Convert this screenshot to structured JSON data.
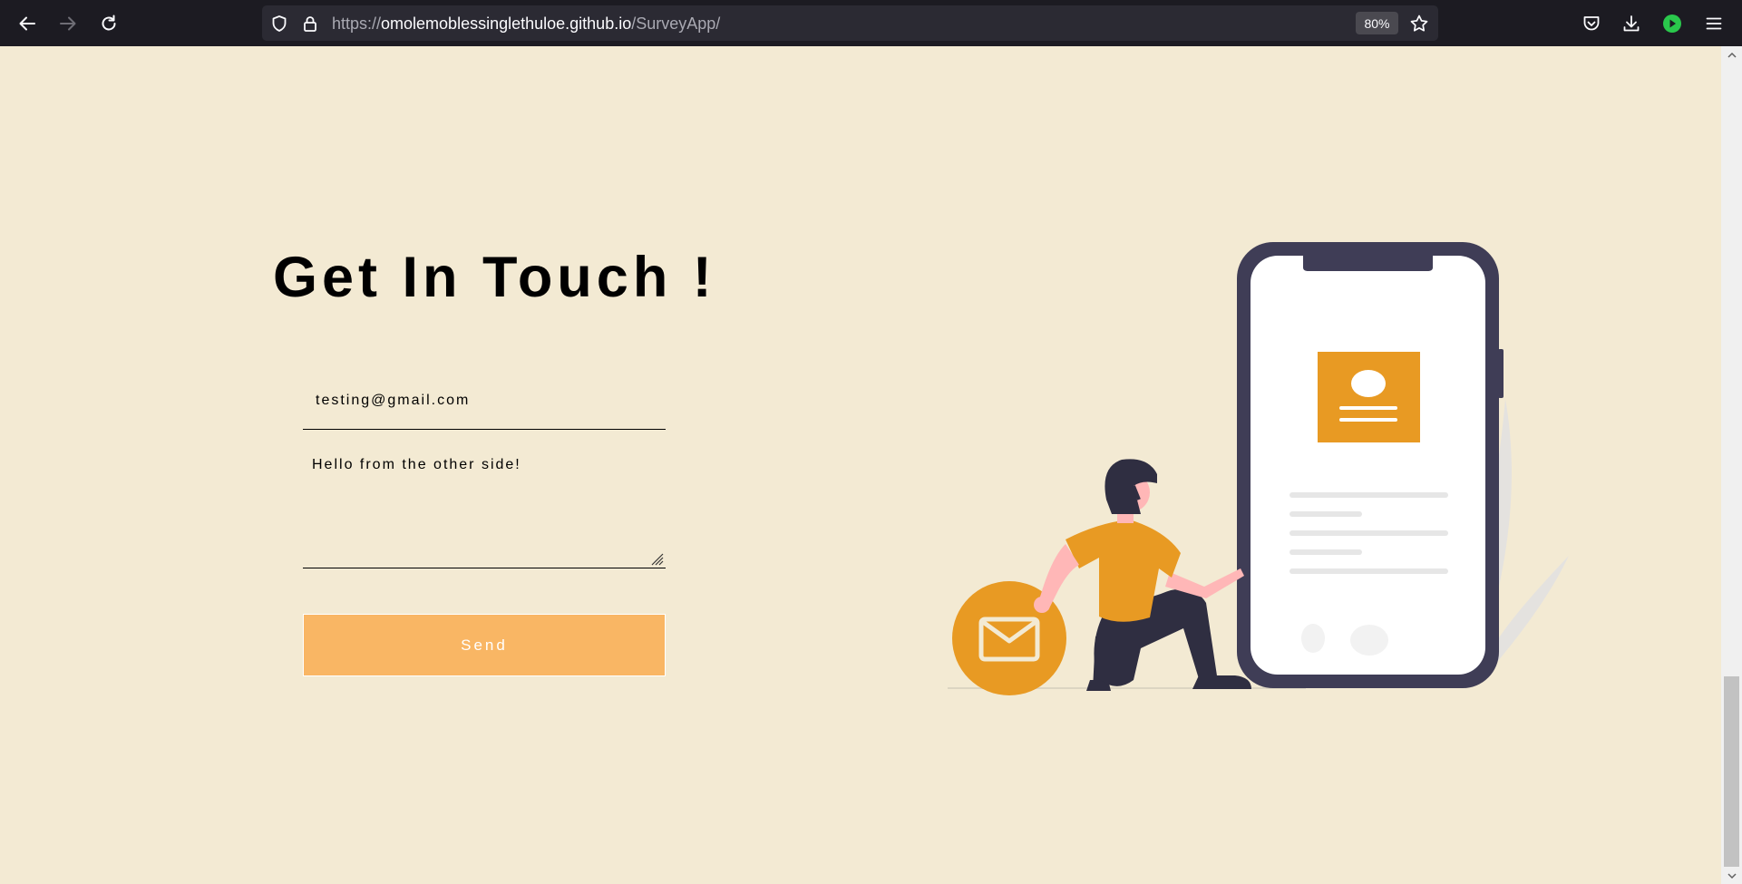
{
  "browser": {
    "url_base": "https://",
    "url_host": "omolemoblessinglethuloe.github.io",
    "url_path": "/SurveyApp/",
    "zoom": "80%",
    "icons": {
      "back": "back-arrow-icon",
      "forward": "forward-arrow-icon",
      "reload": "reload-icon",
      "shield": "tracking-protection-shield-icon",
      "lock": "lock-icon",
      "bookmark": "bookmark-star-icon",
      "pocket": "pocket-icon",
      "downloads": "downloads-icon",
      "extension": "extension-play-icon",
      "menu": "hamburger-menu-icon"
    }
  },
  "page": {
    "heading": "Get In Touch !",
    "form": {
      "email_value": "testing@gmail.com",
      "message_value": "Hello from the other side!",
      "send_label": "Send"
    }
  },
  "colors": {
    "page_background": "#f3ead3",
    "accent_orange": "#e89a23",
    "button": "#f9b664",
    "phone_frame": "#3f3d56",
    "browser_chrome": "#1c1b22",
    "extension_green": "#2ac84c"
  }
}
